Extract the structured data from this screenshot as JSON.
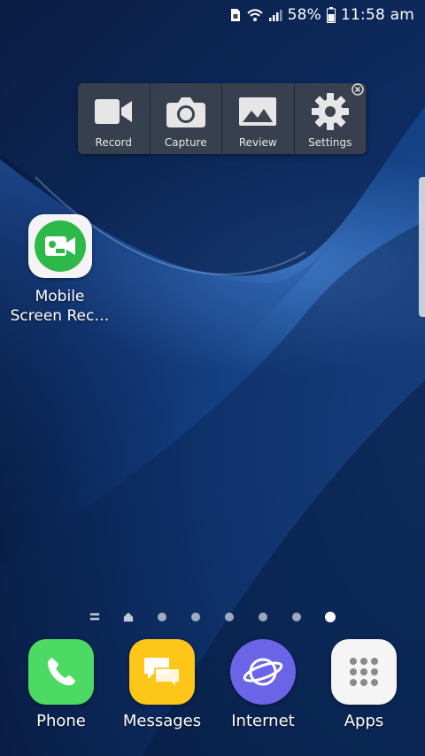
{
  "status_bar": {
    "battery_percent": "58%",
    "time": "11:58 am",
    "icons": [
      "sim-card-icon",
      "wifi-icon",
      "signal-icon",
      "battery-icon"
    ]
  },
  "toolbar": {
    "buttons": [
      {
        "label": "Record",
        "icon": "video-camera-icon"
      },
      {
        "label": "Capture",
        "icon": "camera-icon"
      },
      {
        "label": "Review",
        "icon": "image-icon"
      },
      {
        "label": "Settings",
        "icon": "gear-icon"
      }
    ],
    "close_icon": "close-icon"
  },
  "home_app": {
    "label": "Mobile Screen Rec…",
    "icon": "screen-recorder-icon",
    "accent": "#2fb84a"
  },
  "page_indicator": {
    "pages": 8,
    "active_index": 7
  },
  "dock": {
    "apps": [
      {
        "label": "Phone",
        "icon": "phone-icon",
        "color": "#4cd964"
      },
      {
        "label": "Messages",
        "icon": "messages-icon",
        "color": "#ffc61a"
      },
      {
        "label": "Internet",
        "icon": "internet-icon",
        "color": "#6a64e6"
      },
      {
        "label": "Apps",
        "icon": "apps-grid-icon",
        "color": "#f5f5f5"
      }
    ]
  }
}
